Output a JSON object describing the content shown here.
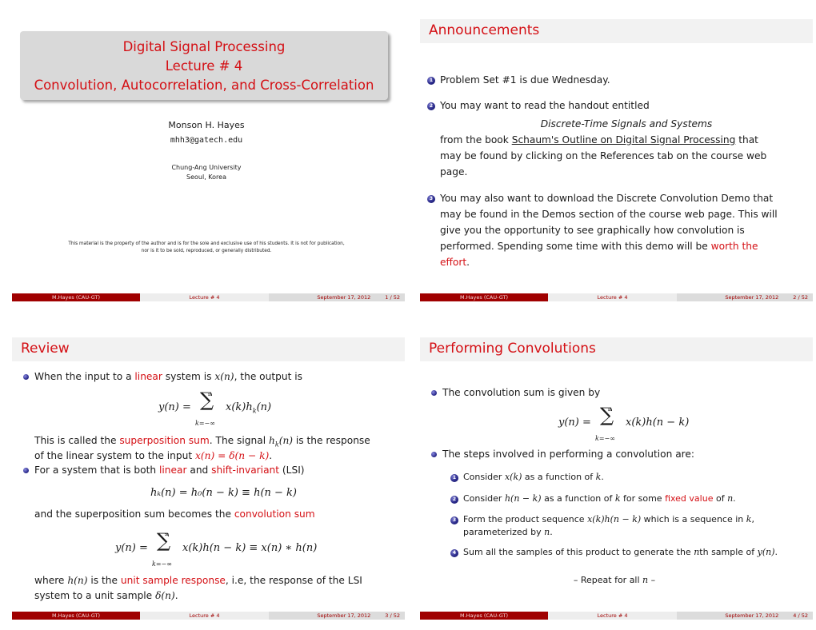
{
  "footer": {
    "author": "M.Hayes  (CAU-GT)",
    "short_title": "Lecture # 4",
    "date": "September 17, 2012",
    "total_pages": "52"
  },
  "slides": [
    {
      "page": "1 / 52",
      "title_lines": [
        "Digital Signal Processing",
        "Lecture # 4",
        "Convolution, Autocorrelation, and Cross-Correlation"
      ],
      "author": "Monson H. Hayes",
      "email": "mhh3@gatech.edu",
      "institution": [
        "Chung-Ang University",
        "Seoul, Korea"
      ],
      "copyright": [
        "This material is the property of the author and is for the sole and exclusive use of his students. It is not for publication,",
        "nor is it to be sold, reproduced, or generally distributed."
      ]
    },
    {
      "page": "2 / 52",
      "title": "Announcements",
      "items": [
        {
          "num": "1",
          "text": "Problem Set #1 is due Wednesday."
        },
        {
          "num": "2",
          "lines": [
            "You may want to read the handout entitled"
          ],
          "italic_center": "Discrete-Time Signals and Systems",
          "pre_link": "from the book ",
          "link": "Schaum's Outline on Digital Signal Processing",
          "post_link": " that",
          "cont": [
            "may be found by clicking on the References tab on the course web",
            "page."
          ]
        },
        {
          "num": "3",
          "lines": [
            "You may also want to download the Discrete Convolution Demo that",
            "may be found in the Demos section of the course web page.  This will",
            "give you the opportunity to see graphically how convolution is"
          ],
          "last_pre": "performed.  Spending some time with this demo will be ",
          "last_red": "worth the",
          "end_red": "effort",
          "end": "."
        }
      ]
    },
    {
      "page": "3 / 52",
      "title": "Review",
      "b1_pre": "When the input to a ",
      "b1_red": "linear",
      "b1_post": " system is ",
      "b1_math": "x(n)",
      "b1_end": ", the output is",
      "eq1_lhs": "y(n) =",
      "eq1_rhs": "x(k)h",
      "eq1_sub": "k",
      "eq1_tail": "(n)",
      "sum_upper": "∞",
      "sum_lower": "k=−∞",
      "sigma": "∑",
      "p1_pre": "This is called the ",
      "p1_red": "superposition sum",
      "p1_mid": ".  The signal ",
      "p1_math": "h",
      "p1_sub": "k",
      "p1_math2": "(n)",
      "p1_end": " is the response",
      "p2_pre": "of the linear system to the input ",
      "p2_red": "x(n) = δ(n − k)",
      "p2_end": ".",
      "b2_pre": "For a system that is both ",
      "b2_red1": "linear",
      "b2_mid": " and ",
      "b2_red2": "shift-invariant",
      "b2_end": " (LSI)",
      "eq2": "hₖ(n) = h₀(n − k) ≡ h(n − k)",
      "p3_pre": "and the superposition sum becomes the ",
      "p3_red": "convolution sum",
      "eq3_lhs": "y(n) =",
      "eq3_rhs": "x(k)h(n − k) ≡ x(n) ∗ h(n)",
      "p4_pre": "where ",
      "p4_math": "h(n)",
      "p4_mid": " is the ",
      "p4_red": "unit sample response",
      "p4_end": ", i.e, the response of the LSI",
      "p5_pre": "system to a unit sample ",
      "p5_math": "δ(n)",
      "p5_end": "."
    },
    {
      "page": "4 / 52",
      "title": "Performing Convolutions",
      "b1": "The convolution sum is given by",
      "eq_lhs": "y(n) =",
      "eq_rhs": "x(k)h(n − k)",
      "b2": "The steps involved in performing a convolution are:",
      "steps": [
        {
          "num": "1",
          "pre": "Consider ",
          "math": "x(k)",
          "post": " as a function of ",
          "math2": "k",
          "end": "."
        },
        {
          "num": "2",
          "pre": "Consider ",
          "math": "h(n − k)",
          "post": " as a function of ",
          "math2": "k",
          "mid": " for some ",
          "red": "fixed value",
          "mid2": " of ",
          "math3": "n",
          "end": "."
        },
        {
          "num": "3",
          "pre": "Form the product sequence ",
          "math": "x(k)h(n − k)",
          "post": " which is a sequence in ",
          "math2": "k",
          "end": ",",
          "line2_pre": "parameterized by ",
          "line2_math": "n",
          "line2_end": "."
        },
        {
          "num": "4",
          "pre": "Sum all the samples of this product to generate the ",
          "math": "n",
          "post": "th sample of ",
          "math2": "y(n)",
          "end": "."
        }
      ],
      "repeat_pre": "– Repeat for all ",
      "repeat_math": "n",
      "repeat_end": " –"
    }
  ]
}
